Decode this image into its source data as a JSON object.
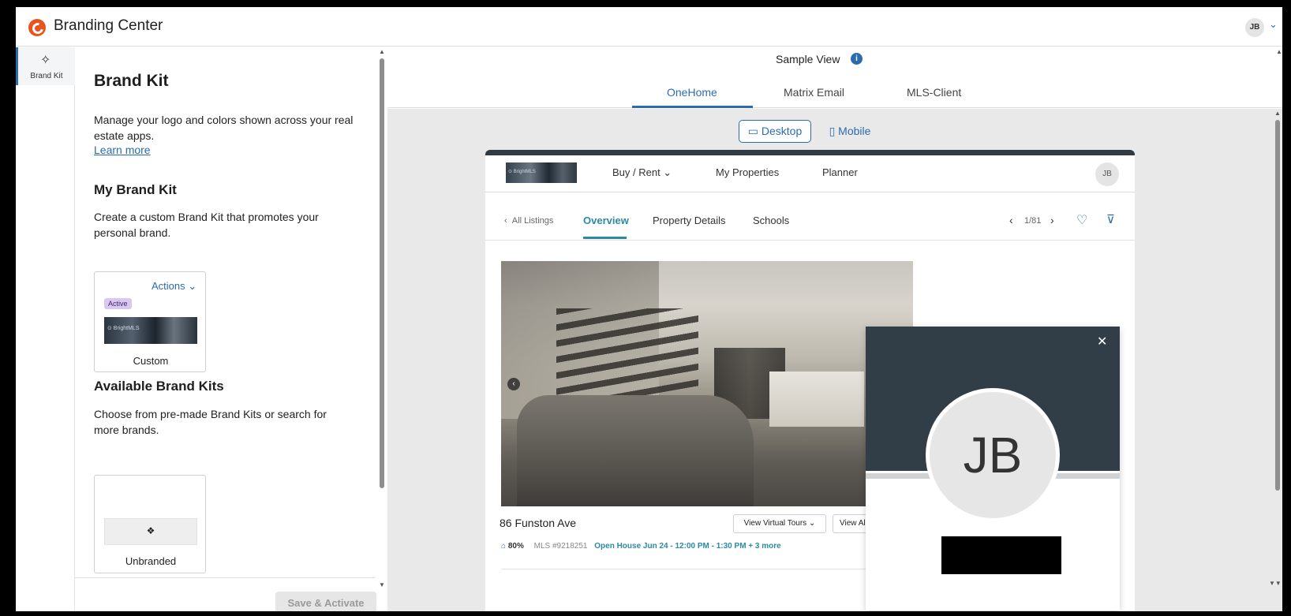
{
  "app": {
    "title": "Branding Center",
    "user_initials": "JB",
    "user_chevron": "⌄"
  },
  "rail": {
    "brand_kit_label": "Brand Kit",
    "brand_kit_icon": "magic-wand-icon"
  },
  "panel": {
    "title": "Brand Kit",
    "description": "Manage your logo and colors shown across your real estate apps.",
    "learn_more": "Learn more",
    "my_brand_kit": {
      "title": "My Brand Kit",
      "description": "Create a custom Brand Kit that promotes your personal brand.",
      "actions_label": "Actions",
      "active_badge": "Active",
      "custom_name": "Custom"
    },
    "available": {
      "title": "Available Brand Kits",
      "description": "Choose from pre-made Brand Kits or search for more brands.",
      "unbranded_icon": "❖",
      "unbranded_name": "Unbranded"
    },
    "save_button": "Save & Activate"
  },
  "preview": {
    "sample_view": "Sample View",
    "tabs": [
      "OneHome",
      "Matrix Email",
      "MLS-Client"
    ],
    "active_tab": "OneHome",
    "device": {
      "desktop": "Desktop",
      "mobile": "Mobile",
      "selected": "Desktop"
    },
    "site": {
      "nav": {
        "buy_rent": "Buy / Rent ⌄",
        "my_properties": "My Properties",
        "planner": "Planner",
        "avatar": "JB"
      },
      "listing_tabs": {
        "back": "All Listings",
        "overview": "Overview",
        "details": "Property Details",
        "schools": "Schools"
      },
      "pager": "1/81",
      "address": "86 Funston Ave",
      "buttons": {
        "virtual_tours": "View Virtual Tours ⌄",
        "view_all": "View Al"
      },
      "meta": {
        "percent": "80%",
        "mls": "MLS #9218251",
        "open_house": "Open House Jun 24 - 12:00 PM - 1:30 PM + 3 more"
      }
    },
    "agent_card": {
      "initials": "JB",
      "close": "✕"
    }
  },
  "colors": {
    "accent": "#2b6cb0",
    "logo": "#e8541e",
    "banner": "#323e47",
    "active_badge": "#d8c8f2",
    "teal": "#2b8aa6"
  }
}
